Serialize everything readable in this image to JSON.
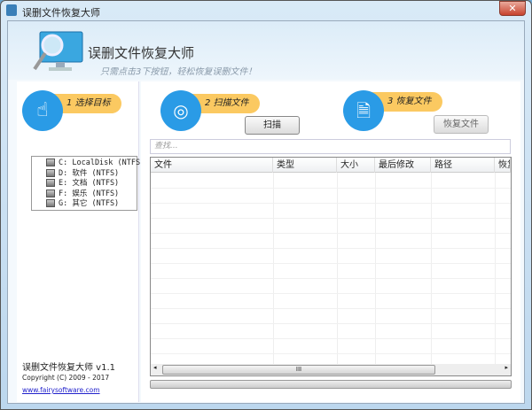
{
  "window": {
    "title": "误删文件恢复大师",
    "close_label": "✕"
  },
  "header": {
    "title": "误删文件恢复大师",
    "subtitle": "只需点击3下按钮，轻松恢复误删文件！"
  },
  "steps": [
    {
      "label": "1 选择目标"
    },
    {
      "label": "2 扫描文件"
    },
    {
      "label": "3 恢复文件"
    }
  ],
  "drives": [
    {
      "label": "C: LocalDisk (NTFS)"
    },
    {
      "label": "D: 软件 (NTFS)"
    },
    {
      "label": "E: 文档 (NTFS)"
    },
    {
      "label": "F: 娱乐 (NTFS)"
    },
    {
      "label": "G: 其它 (NTFS)"
    }
  ],
  "buttons": {
    "scan": "扫描",
    "recover": "恢复文件"
  },
  "search": {
    "placeholder": "查找..."
  },
  "table": {
    "columns": [
      "文件",
      "类型",
      "大小",
      "最后修改",
      "路径",
      "恢复"
    ]
  },
  "scrollbar": {
    "grip": "III",
    "left": "◂",
    "right": "▸"
  },
  "footer": {
    "version": "误删文件恢复大师 v1.1",
    "copyright": "Copyright (C) 2009 - 2017",
    "link": "www.fairysoftware.com"
  },
  "colors": {
    "accent": "#2a9be6",
    "step_badge": "#fbc961"
  }
}
